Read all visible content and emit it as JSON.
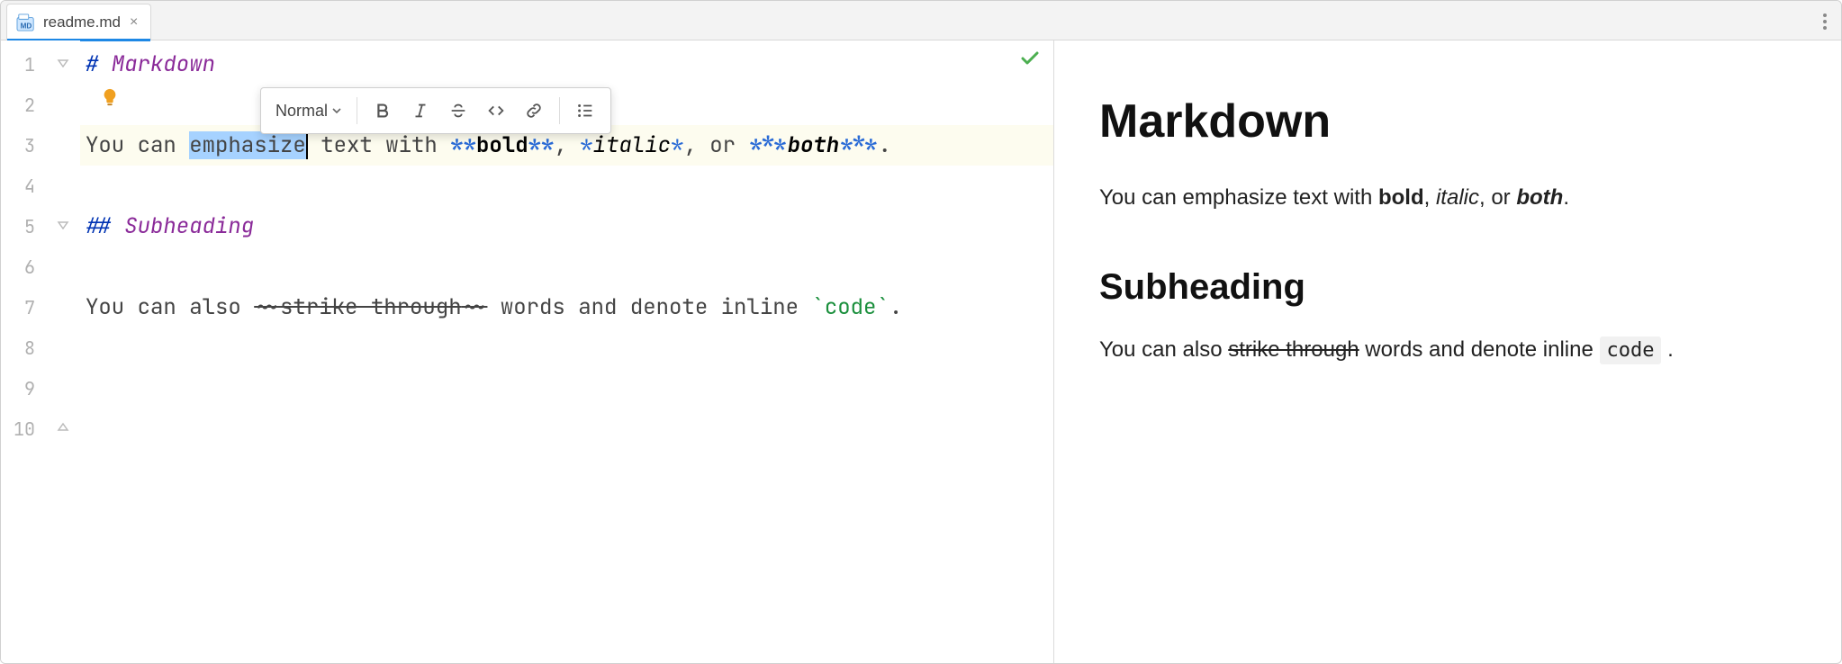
{
  "tab": {
    "filename": "readme.md"
  },
  "gutter": {
    "lines": [
      "1",
      "2",
      "3",
      "4",
      "5",
      "6",
      "7",
      "8",
      "9",
      "10"
    ]
  },
  "toolbar": {
    "style_label": "Normal"
  },
  "source": {
    "line1": {
      "hash": "# ",
      "heading": "Markdown"
    },
    "line3": {
      "t0": "You can ",
      "sel": "emphasize",
      "t1": " text with ",
      "s1": "**",
      "bold": "bold",
      "s2": "**",
      "t2": ", ",
      "s3": "*",
      "italic": "italic",
      "s4": "*",
      "t3": ", or ",
      "s5": "***",
      "both": "both",
      "s6": "***",
      "t4": "."
    },
    "line5": {
      "hash": "## ",
      "heading": "Subheading"
    },
    "line7": {
      "t0": "You can also ",
      "tilde1": "~~",
      "strike": "strike through",
      "tilde2": "~~",
      "t1": " words and denote inline ",
      "tick1": "`",
      "code": "code",
      "tick2": "`",
      "t2": "."
    }
  },
  "preview": {
    "h1": "Markdown",
    "p1": {
      "a": "You can emphasize text with ",
      "bold": "bold",
      "b": ", ",
      "italic": "italic",
      "c": ", or ",
      "both": "both",
      "d": "."
    },
    "h2": "Subheading",
    "p2": {
      "a": "You can also ",
      "strike": "strike through",
      "b": " words and denote inline ",
      "code": "code",
      "c": " ."
    }
  }
}
